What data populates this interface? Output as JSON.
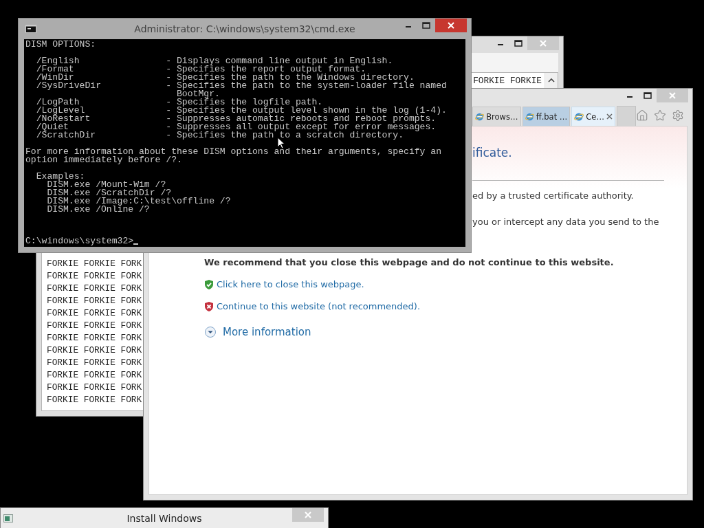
{
  "notepad": {
    "active": false,
    "top_line": "FORKIE FORKIE",
    "lines": [
      "FORKIE FORKIE FORK",
      "FORKIE FORKIE FORK",
      "FORKIE FORKIE FORK",
      "FORKIE FORKIE FORK",
      "FORKIE FORKIE FORK",
      "FORKIE FORKIE FORK",
      "FORKIE FORKIE FORK",
      "FORKIE FORKIE FORK",
      "FORKIE FORKIE FORK",
      "FORKIE FORKIE FORK",
      "FORKIE FORKIE FORK",
      "FORKIE FORKIE FORK"
    ]
  },
  "browser": {
    "active": false,
    "tabs": [
      {
        "label": "Brows…",
        "selected": false,
        "hovered": false
      },
      {
        "label": "ff.bat …",
        "selected": false,
        "hovered": true
      },
      {
        "label": "Ce…",
        "selected": true,
        "hovered": false
      }
    ],
    "heading": "ificate.",
    "paragraphs": [
      "ed by a trusted certificate authority.",
      "you or intercept any data you send to the"
    ],
    "warning": "We recommend that you close this webpage and do not continue to this website.",
    "links": [
      {
        "kind": "safe",
        "text": "Click here to close this webpage."
      },
      {
        "kind": "unsafe",
        "text": "Continue to this website (not recommended)."
      }
    ],
    "more": "More information"
  },
  "cmd": {
    "active": true,
    "title": "Administrator: C:\\windows\\system32\\cmd.exe",
    "blocks": [
      [
        "DISM OPTIONS:"
      ],
      [
        "  /English                - Displays command line output in English.",
        "  /Format                 - Specifies the report output format.",
        "  /WinDir                 - Specifies the path to the Windows directory.",
        "  /SysDriveDir            - Specifies the path to the system-loader file named",
        "                            BootMgr.",
        "  /LogPath                - Specifies the logfile path.",
        "  /LogLevel               - Specifies the output level shown in the log (1-4).",
        "  /NoRestart              - Suppresses automatic reboots and reboot prompts.",
        "  /Quiet                  - Suppresses all output except for error messages.",
        "  /ScratchDir             - Specifies the path to a scratch directory."
      ],
      [
        "For more information about these DISM options and their arguments, specify an",
        "option immediately before /?."
      ],
      [
        "  Examples:",
        "    DISM.exe /Mount-Wim /?",
        "    DISM.exe /ScratchDir /?",
        "    DISM.exe /Image:C:\\test\\offline /?",
        "    DISM.exe /Online /?"
      ]
    ],
    "prompt": "C:\\windows\\system32>"
  },
  "installer": {
    "active": false,
    "title": "Install Windows"
  }
}
